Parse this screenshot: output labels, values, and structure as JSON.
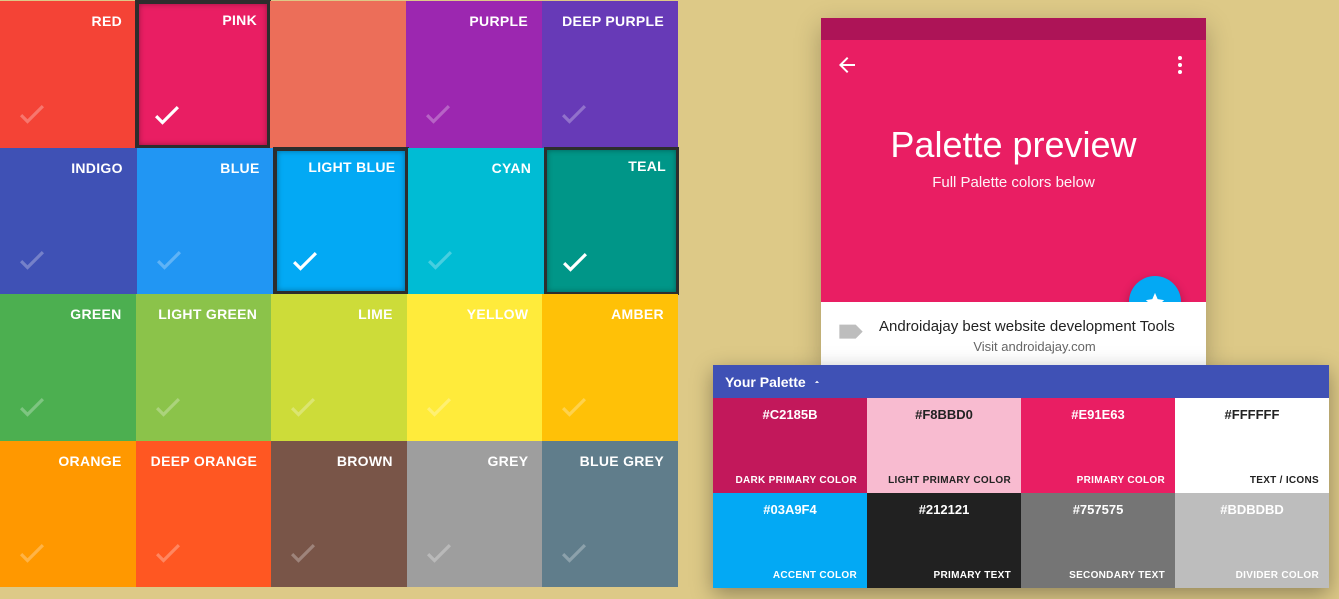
{
  "swatches": [
    [
      {
        "name": "RED",
        "color": "#f44336",
        "selected": false,
        "id": "red"
      },
      {
        "name": "PINK",
        "color": "#e91e63",
        "selected": true,
        "id": "pink"
      },
      {
        "name": "",
        "color": "#ec6e59",
        "selected": false,
        "id": "pattern",
        "check": false
      },
      {
        "name": "PURPLE",
        "color": "#9c27b0",
        "selected": false,
        "id": "purple"
      },
      {
        "name": "DEEP PURPLE",
        "color": "#673ab7",
        "selected": false,
        "id": "deep-purple"
      }
    ],
    [
      {
        "name": "INDIGO",
        "color": "#3f51b5",
        "selected": false,
        "id": "indigo"
      },
      {
        "name": "BLUE",
        "color": "#2196f3",
        "selected": false,
        "id": "blue"
      },
      {
        "name": "LIGHT BLUE",
        "color": "#03a9f4",
        "selected": true,
        "id": "light-blue"
      },
      {
        "name": "CYAN",
        "color": "#00bcd4",
        "selected": false,
        "id": "cyan"
      },
      {
        "name": "TEAL",
        "color": "#009688",
        "selected": true,
        "id": "teal",
        "thinBorder": true
      }
    ],
    [
      {
        "name": "GREEN",
        "color": "#4caf50",
        "selected": false,
        "id": "green"
      },
      {
        "name": "LIGHT GREEN",
        "color": "#8bc34a",
        "selected": false,
        "id": "light-green"
      },
      {
        "name": "LIME",
        "color": "#cddc39",
        "selected": false,
        "id": "lime"
      },
      {
        "name": "YELLOW",
        "color": "#ffeb3b",
        "selected": false,
        "id": "yellow"
      },
      {
        "name": "AMBER",
        "color": "#ffc107",
        "selected": false,
        "id": "amber"
      }
    ],
    [
      {
        "name": "ORANGE",
        "color": "#ff9800",
        "selected": false,
        "id": "orange"
      },
      {
        "name": "DEEP ORANGE",
        "color": "#ff5722",
        "selected": false,
        "id": "deep-orange"
      },
      {
        "name": "BROWN",
        "color": "#795548",
        "selected": false,
        "id": "brown"
      },
      {
        "name": "GREY",
        "color": "#9e9e9e",
        "selected": false,
        "id": "grey"
      },
      {
        "name": "BLUE GREY",
        "color": "#607d8b",
        "selected": false,
        "id": "blue-grey"
      }
    ]
  ],
  "preview": {
    "title": "Palette preview",
    "subtitle": "Full Palette colors below",
    "card_line1": "Androidajay best website development Tools",
    "card_line2": "Visit androidajay.com"
  },
  "panel": {
    "title": "Your Palette",
    "cells": [
      {
        "hex": "#C2185B",
        "role": "DARK PRIMARY COLOR",
        "bg": "#c2185b",
        "txtClass": "dark"
      },
      {
        "hex": "#F8BBD0",
        "role": "LIGHT PRIMARY COLOR",
        "bg": "#f8bbd0",
        "txtClass": "light"
      },
      {
        "hex": "#E91E63",
        "role": "PRIMARY COLOR",
        "bg": "#e91e63",
        "txtClass": "dark"
      },
      {
        "hex": "#FFFFFF",
        "role": "TEXT / ICONS",
        "bg": "#ffffff",
        "txtClass": "light"
      },
      {
        "hex": "#03A9F4",
        "role": "ACCENT COLOR",
        "bg": "#03a9f4",
        "txtClass": "dark"
      },
      {
        "hex": "#212121",
        "role": "PRIMARY TEXT",
        "bg": "#212121",
        "txtClass": "dark"
      },
      {
        "hex": "#757575",
        "role": "SECONDARY TEXT",
        "bg": "#757575",
        "txtClass": "dark"
      },
      {
        "hex": "#BDBDBD",
        "role": "DIVIDER COLOR",
        "bg": "#bdbdbd",
        "txtClass": "dark"
      }
    ]
  }
}
